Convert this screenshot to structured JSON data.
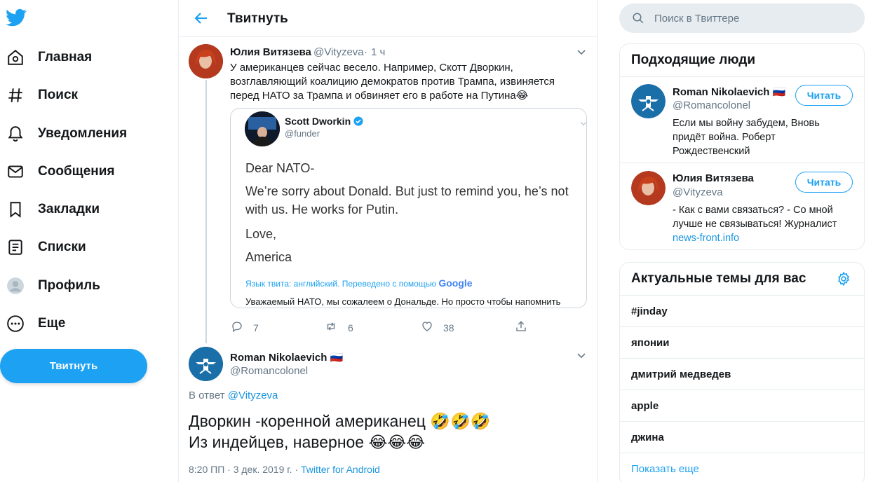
{
  "nav": {
    "items": [
      {
        "label": "Главная",
        "icon": "home-icon"
      },
      {
        "label": "Поиск",
        "icon": "hashtag-icon"
      },
      {
        "label": "Уведомления",
        "icon": "bell-icon"
      },
      {
        "label": "Сообщения",
        "icon": "mail-icon"
      },
      {
        "label": "Закладки",
        "icon": "bookmark-icon"
      },
      {
        "label": "Списки",
        "icon": "list-icon"
      },
      {
        "label": "Профиль",
        "icon": "profile-avatar-icon"
      },
      {
        "label": "Еще",
        "icon": "more-circle-icon"
      }
    ],
    "tweet_button": "Твитнуть",
    "accent": "#1da1f2"
  },
  "header": {
    "title": "Твитнуть"
  },
  "tweet1": {
    "name": "Юлия Витязева",
    "handle": "@Vityzeva",
    "dot": "·",
    "time": "1 ч",
    "text": "У американцев сейчас весело. Например, Скотт Дворкин, возглавляющий коалицию демократов против Трампа, извиняется перед НАТО за Трампа и обвиняет его в работе на Путина😂",
    "quote": {
      "name": "Scott Dworkin",
      "handle": "@funder",
      "line1": "Dear NATO-",
      "line2a": "We’re sorry about Donald. But just to remind you, he’s not",
      "line2b": "with us. He works for Putin.",
      "line3": "Love,",
      "line4": "America",
      "translate_note": "Язык твита: английский. Переведено с помощью",
      "google": "Google",
      "translated": "Уважаемый НАТО, мы сожалеем о Дональде. Но просто чтобы напомнить"
    },
    "replies": "7",
    "retweets": "6",
    "likes": "38"
  },
  "tweet2": {
    "name": "Roman Nikolaevich",
    "flag": "🇷🇺",
    "handle": "@Romancolonel",
    "reply_prefix": "В ответ",
    "reply_to": "@Vityzeva",
    "line1": "Дворкин -коренной американец 🤣🤣🤣",
    "line2": "Из индейцев, наверное 😂😂😂",
    "time": "8:20 ПП · 3 дек. 2019 г. ·",
    "source": "Twitter for Android"
  },
  "search": {
    "placeholder": "Поиск в Твиттере"
  },
  "who_to_follow": {
    "title": "Подходящие люди",
    "people": [
      {
        "name": "Roman Nikolaevich",
        "flag": "🇷🇺",
        "handle": "@Romancolonel",
        "bio": "Если мы войну забудем, Вновь придёт война. Роберт Рождественский",
        "button": "Читать"
      },
      {
        "name": "Юлия Витязева",
        "handle": "@Vityzeva",
        "bio": "- Как с вами связаться? - Со мной лучше не связываться! Журналист",
        "bio_link": "news-front.info",
        "button": "Читать"
      }
    ]
  },
  "trends": {
    "title": "Актуальные темы для вас",
    "items": [
      "#jinday",
      "японии",
      "дмитрий медведев",
      "apple",
      "джина"
    ],
    "show_more": "Показать еще"
  }
}
